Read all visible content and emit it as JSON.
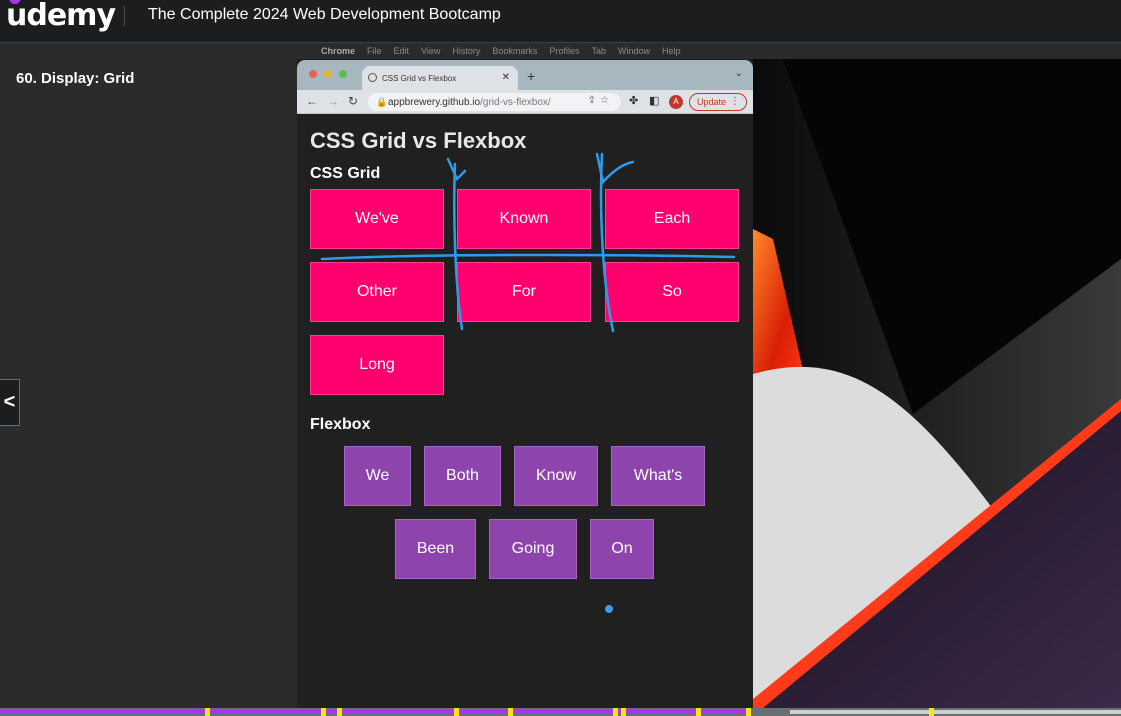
{
  "udemy": {
    "logo": "udemy",
    "course_title": "The Complete 2024 Web Development Bootcamp",
    "lecture_title": "60. Display: Grid",
    "prev_icon": "<",
    "brand_color": "#a435f0"
  },
  "mac_menu": {
    "items": [
      "Chrome",
      "File",
      "Edit",
      "View",
      "History",
      "Bookmarks",
      "Profiles",
      "Tab",
      "Window",
      "Help"
    ]
  },
  "browser": {
    "tab_title": "CSS Grid vs Flexbox",
    "url_host": "appbrewery.github.io",
    "url_path": "/grid-vs-flexbox/",
    "avatar_letter": "A",
    "update_label": "Update"
  },
  "page": {
    "title": "CSS Grid vs Flexbox",
    "grid_heading": "CSS Grid",
    "grid_items": [
      "We've",
      "Known",
      "Each",
      "Other",
      "For",
      "So",
      "Long"
    ],
    "flex_heading": "Flexbox",
    "flex_items": [
      "We",
      "Both",
      "Know",
      "What's",
      "Been",
      "Going",
      "On"
    ],
    "grid_color": "#ff006e",
    "flex_color": "#8e44ad"
  },
  "video_progress": {
    "watched_fraction": 0.67
  }
}
